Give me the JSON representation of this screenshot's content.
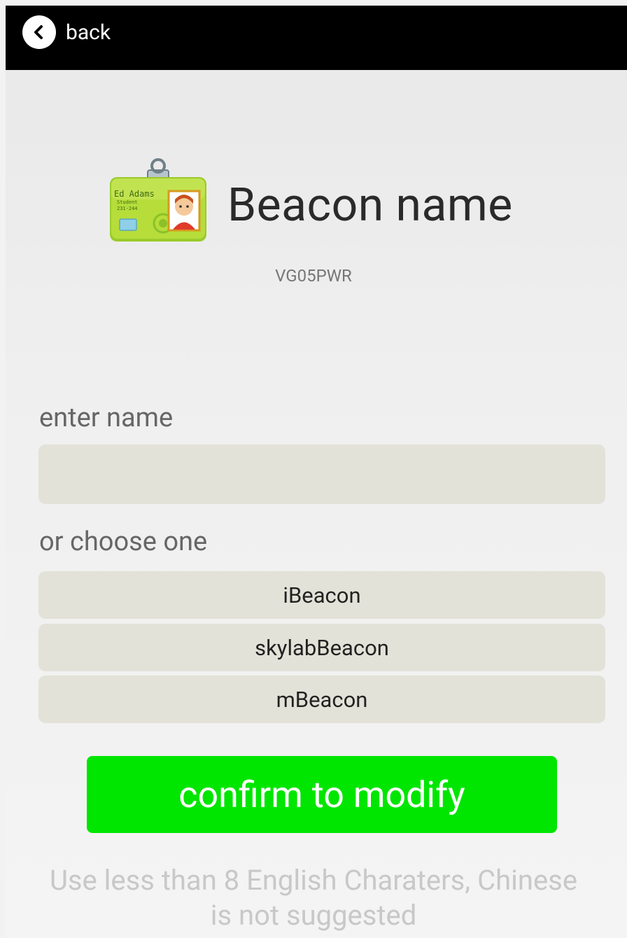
{
  "navbar": {
    "back_label": "back"
  },
  "header": {
    "title": "Beacon name",
    "subtitle": "VG05PWR",
    "badge_name": "Ed Adams",
    "badge_role": "Student",
    "badge_id": "231-244"
  },
  "form": {
    "enter_label": "enter name",
    "input_value": "",
    "choose_label": "or choose one",
    "options": [
      "iBeacon",
      "skylabBeacon",
      "mBeacon"
    ]
  },
  "confirm_label": "confirm to modify",
  "hint": {
    "line1": "Use less than 8 English Charaters, Chinese",
    "line2": "is not suggested"
  },
  "colors": {
    "navbar": "#000000",
    "confirm": "#00e600",
    "field_bg": "#e2e2d8"
  }
}
